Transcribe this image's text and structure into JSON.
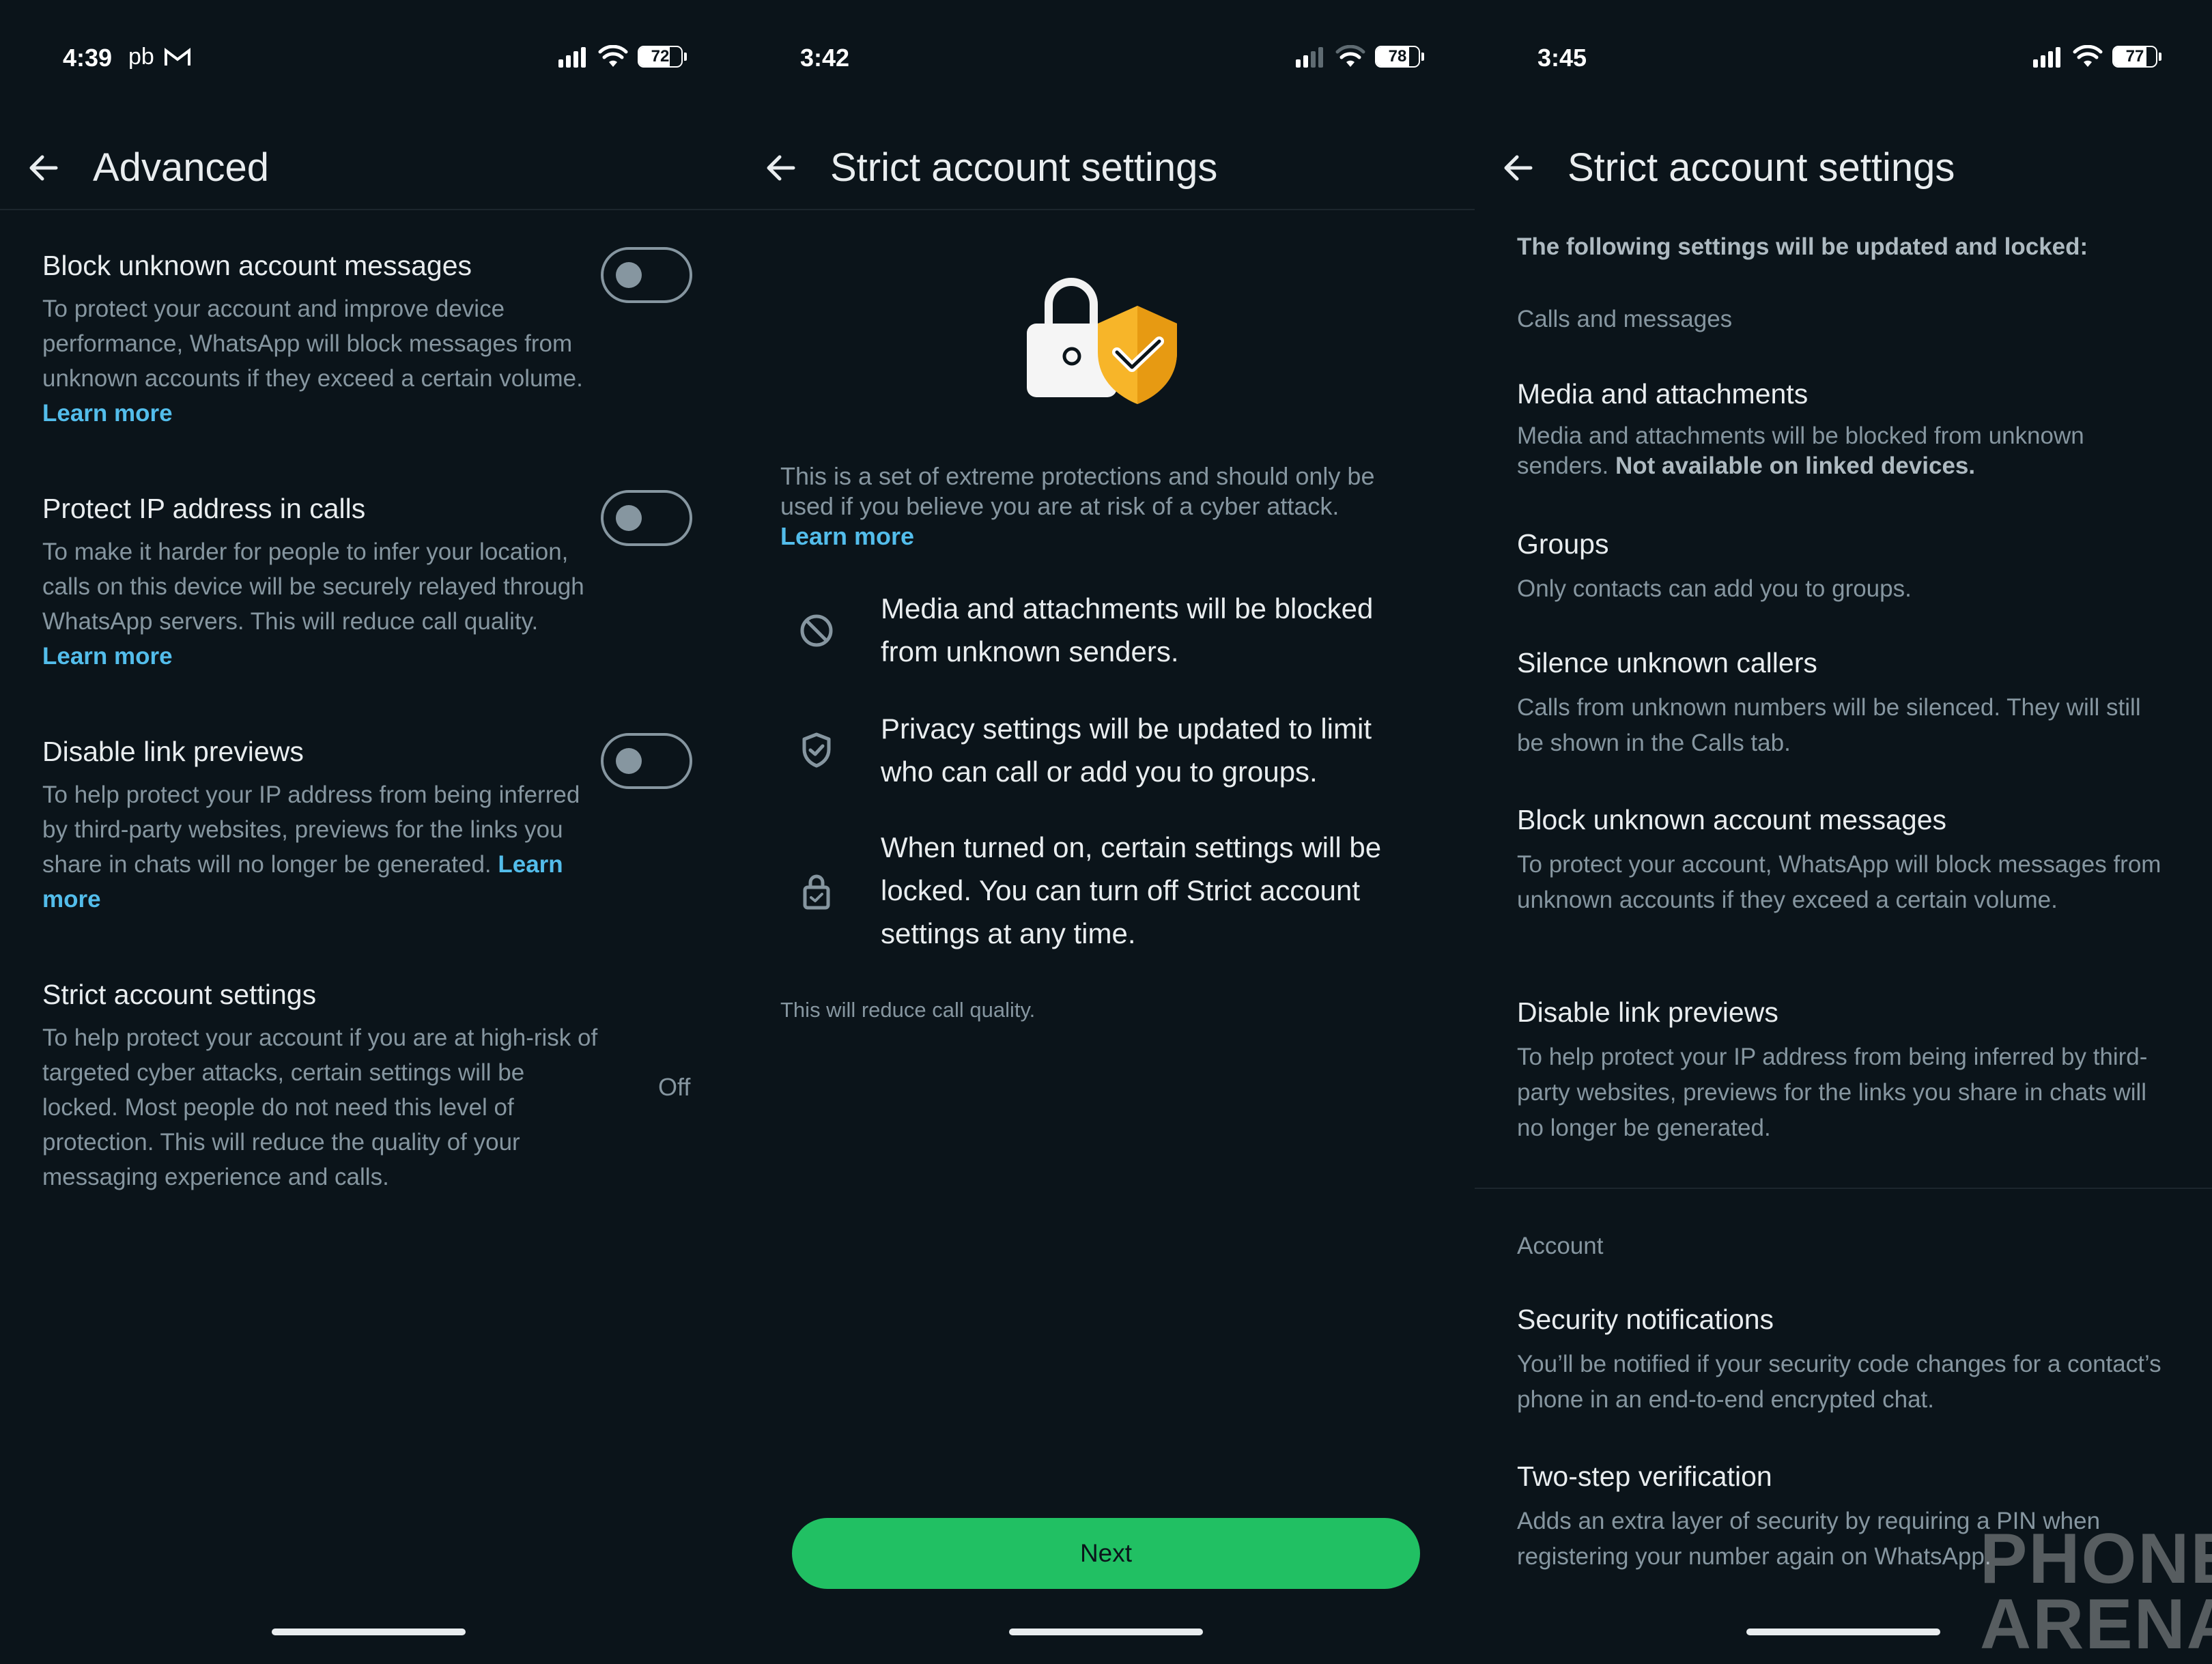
{
  "colors": {
    "background": "#0b141a",
    "primary_text": "#e9edef",
    "secondary_text": "#8696a0",
    "link": "#53bdeb",
    "accent_green": "#21c063",
    "shield": "#f7b529"
  },
  "screen1": {
    "status": {
      "time": "4:39",
      "extra": "pb",
      "battery": "72",
      "battery_level": 0.72
    },
    "title": "Advanced",
    "settings": [
      {
        "title": "Block unknown account messages",
        "desc": "To protect your account and improve device performance, WhatsApp will block messages from unknown accounts if they exceed a certain volume.",
        "link": "Learn more",
        "enabled": false
      },
      {
        "title": "Protect IP address in calls",
        "desc": "To make it harder for people to infer your location, calls on this device will be securely relayed through WhatsApp servers. This will reduce call quality.",
        "link": "Learn more",
        "enabled": false
      },
      {
        "title": "Disable link previews",
        "desc": "To help protect your IP address from being inferred by third-party websites, previews for the links you share in chats will no longer be generated.",
        "link": "Learn more",
        "enabled": false
      },
      {
        "title": "Strict account settings",
        "desc": "To help protect your account if you are at high-risk of targeted cyber attacks, certain settings will be locked. Most people do not need this level of protection. This will reduce the quality of your messaging experience and calls.",
        "value": "Off"
      }
    ]
  },
  "screen2": {
    "status": {
      "time": "3:42",
      "battery": "78",
      "battery_level": 0.78
    },
    "title": "Strict account settings",
    "intro": "This is a set of extreme protections and should only be used if you believe you are at risk of a cyber attack.",
    "intro_link": "Learn more",
    "features": [
      {
        "icon": "block-icon",
        "text": "Media and attachments will be blocked from unknown senders."
      },
      {
        "icon": "shield-check-icon",
        "text": "Privacy settings will be updated to limit who can call or add you to groups."
      },
      {
        "icon": "lock-check-icon",
        "text": "When turned on, certain settings will be locked. You can turn off Strict account settings at any time."
      }
    ],
    "note": "This will reduce call quality.",
    "next_label": "Next"
  },
  "screen3": {
    "status": {
      "time": "3:45",
      "battery": "77",
      "battery_level": 0.77
    },
    "title": "Strict account settings",
    "header": "The following settings will be updated and locked:",
    "section1": "Calls and messages",
    "items1": [
      {
        "title": "Media and attachments",
        "desc": "Media and attachments will be blocked from unknown senders.",
        "bold": "Not available on linked devices."
      },
      {
        "title": "Groups",
        "desc": "Only contacts can add you to groups."
      },
      {
        "title": "Silence unknown callers",
        "desc": "Calls from unknown numbers will be silenced. They will still be shown in the Calls tab."
      },
      {
        "title": "Block unknown account messages",
        "desc": "To protect your account, WhatsApp will block messages from unknown accounts if they exceed a certain volume."
      },
      {
        "title": "Disable link previews",
        "desc": "To help protect your IP address from being inferred by third-party websites, previews for the links you share in chats will no longer be generated."
      }
    ],
    "section2": "Account",
    "items2": [
      {
        "title": "Security notifications",
        "desc": "You’ll be notified if your security code changes for a contact’s phone in an end-to-end encrypted chat."
      },
      {
        "title": "Two-step verification",
        "desc": "Adds an extra layer of security by requiring a PIN when registering your number again on WhatsApp."
      }
    ]
  },
  "watermark": {
    "line1": "PHONE",
    "line2": "ARENA"
  }
}
